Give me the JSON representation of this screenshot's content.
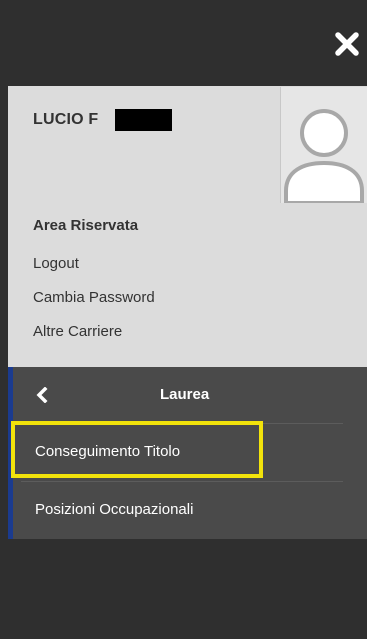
{
  "header": {
    "close_icon": "close-icon"
  },
  "user": {
    "name": "LUCIO F",
    "avatar_icon": "avatar-placeholder-icon"
  },
  "area": {
    "title": "Area Riservata",
    "links": [
      "Logout",
      "Cambia Password",
      "Altre Carriere"
    ]
  },
  "submenu": {
    "back_icon": "chevron-left-icon",
    "title": "Laurea",
    "items": [
      "Conseguimento Titolo",
      "Posizioni Occupazionali"
    ]
  },
  "colors": {
    "topbar": "#2f2f2f",
    "user_panel": "#dcdcdc",
    "submenu": "#4a4a4a",
    "accent": "#1b3b8f",
    "highlight": "#f2e30b"
  }
}
